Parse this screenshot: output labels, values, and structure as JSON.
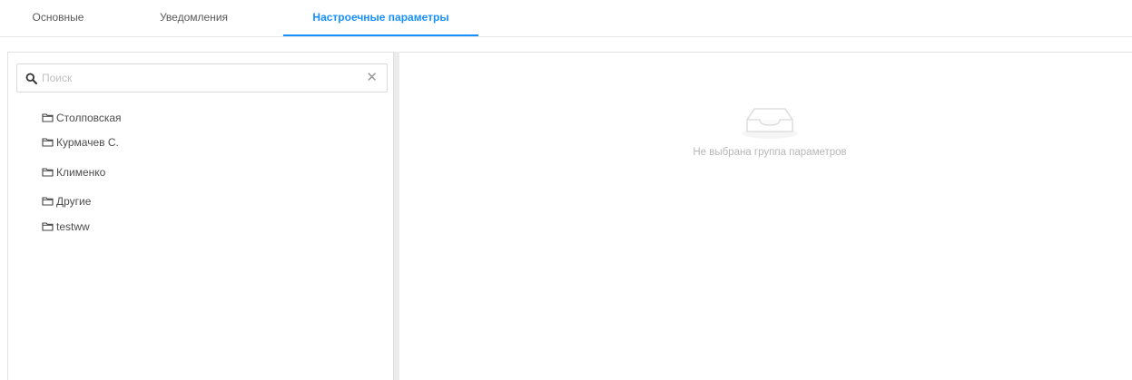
{
  "tabs": [
    {
      "label": "Основные",
      "active": false
    },
    {
      "label": "Уведомления",
      "active": false
    },
    {
      "label": "Настроечные параметры",
      "active": true
    }
  ],
  "search": {
    "placeholder": "Поиск",
    "value": "",
    "search_icon": "search-icon",
    "clear_icon": "close-icon"
  },
  "tree": {
    "icon": "folder-icon",
    "items": [
      {
        "label": "Столповская"
      },
      {
        "label": "Курмачев С."
      },
      {
        "label": "Клименко"
      },
      {
        "label": "Другие"
      },
      {
        "label": "testww"
      }
    ]
  },
  "empty_state": {
    "icon": "inbox-icon",
    "text": "Не выбрана группа параметров"
  },
  "colors": {
    "accent": "#1890ff",
    "border": "#e3e3e3",
    "muted_text": "#b7b7b7"
  }
}
